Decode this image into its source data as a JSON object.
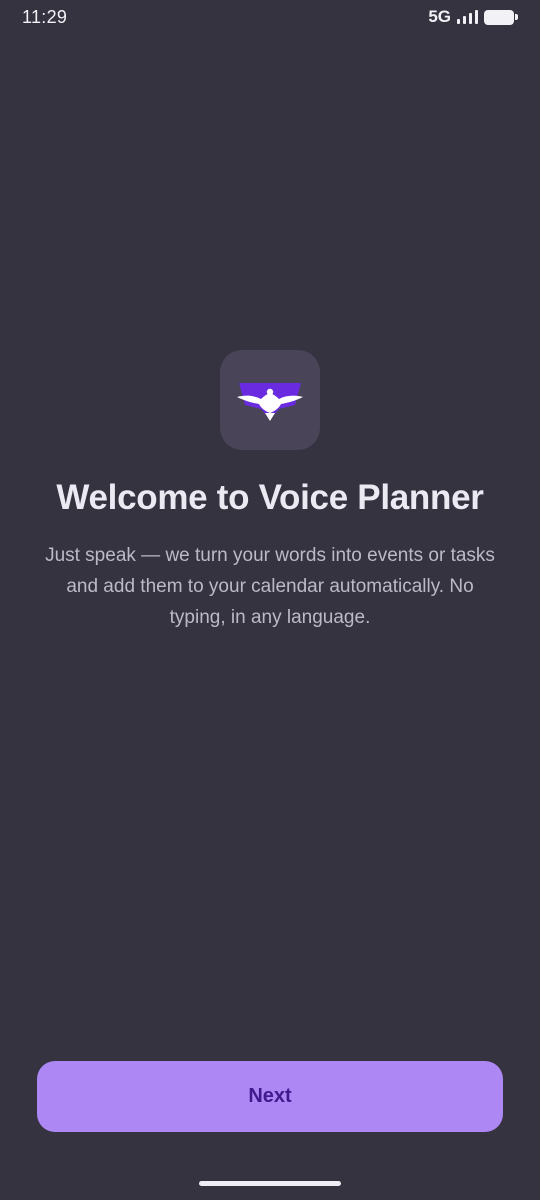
{
  "status_bar": {
    "time": "11:29",
    "network": "5G",
    "icons": [
      "signal-icon",
      "battery-icon"
    ]
  },
  "onboarding": {
    "app_icon": "eagle-logo-icon",
    "title": "Welcome to Voice Planner",
    "subtitle": "Just speak — we turn your words into events or tasks and add them to your calendar automatically. No typing, in any language.",
    "next_label": "Next"
  },
  "colors": {
    "background": "#34333f",
    "accent": "#ad87f4",
    "button_text": "#3f1a8e",
    "icon_purple": "#6a2be0"
  }
}
